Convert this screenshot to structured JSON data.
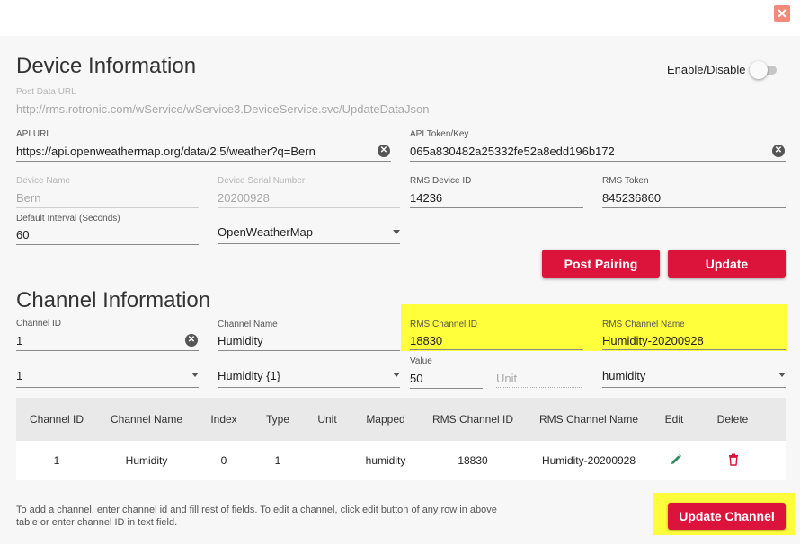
{
  "dialog": {
    "close_glyph": "✕"
  },
  "device": {
    "title": "Device Information",
    "enable_label": "Enable/Disable",
    "enabled": false,
    "post_url": {
      "label": "Post Data URL",
      "value": "http://rms.rotronic.com/wService/wService3.DeviceService.svc/UpdateDataJson"
    },
    "api_url": {
      "label": "API URL",
      "value": "https://api.openweathermap.org/data/2.5/weather?q=Bern"
    },
    "api_token": {
      "label": "API Token/Key",
      "value": "065a830482a25332fe52a8edd196b172"
    },
    "device_name": {
      "label": "Device Name",
      "value": "Bern"
    },
    "serial": {
      "label": "Device Serial Number",
      "value": "20200928"
    },
    "rms_device_id": {
      "label": "RMS Device ID",
      "value": "14236"
    },
    "rms_token": {
      "label": "RMS Token",
      "value": "845236860"
    },
    "interval": {
      "label": "Default Interval (Seconds)",
      "value": "60"
    },
    "source": {
      "value": "OpenWeatherMap"
    },
    "post_pairing_label": "Post Pairing",
    "update_label": "Update"
  },
  "channel": {
    "title": "Channel Information",
    "channel_id": {
      "label": "Channel ID",
      "value": "1"
    },
    "channel_name": {
      "label": "Channel Name",
      "value": "Humidity"
    },
    "rms_channel_id": {
      "label": "RMS Channel ID",
      "value": "18830"
    },
    "rms_channel_name": {
      "label": "RMS Channel Name",
      "value": "Humidity-20200928"
    },
    "index_select": {
      "value": "1"
    },
    "type_select": {
      "value": "Humidity {1}"
    },
    "value_field": {
      "label": "Value",
      "value": "50"
    },
    "unit_field": {
      "placeholder": "Unit"
    },
    "mapped_select": {
      "value": "humidity"
    },
    "update_channel_label": "Update Channel"
  },
  "table": {
    "headers": [
      "Channel ID",
      "Channel Name",
      "Index",
      "Type",
      "Unit",
      "Mapped",
      "RMS Channel ID",
      "RMS Channel Name",
      "Edit",
      "Delete"
    ],
    "rows": [
      {
        "channel_id": "1",
        "channel_name": "Humidity",
        "index": "0",
        "type": "1",
        "unit": "",
        "mapped": "humidity",
        "rms_channel_id": "18830",
        "rms_channel_name": "Humidity-20200928",
        "edit_icon": "pencil-icon",
        "delete_icon": "trash-icon"
      }
    ]
  },
  "note": "To add a channel, enter channel id and fill rest of fields. To edit a channel, click edit button of any row in above table or enter channel ID in text field.",
  "colors": {
    "accent": "#dc143c",
    "highlight": "#ffff3b",
    "edit_icon": "#2e8b57"
  }
}
